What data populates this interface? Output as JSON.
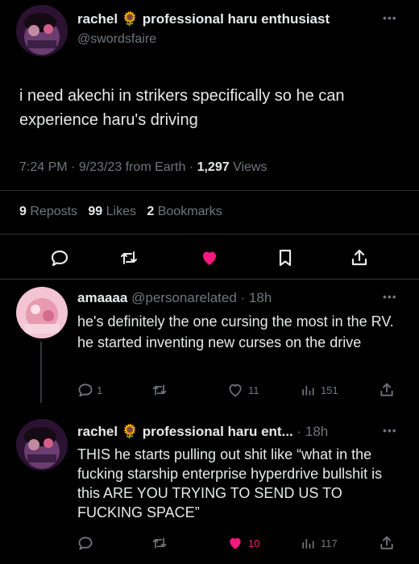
{
  "main_tweet": {
    "display_name": "rachel",
    "emoji": "🌻",
    "name_suffix": "professional haru enthusiast",
    "handle": "@swordsfaire",
    "text": "i need akechi in strikers specifically so he can experience haru's driving",
    "time": "7:24 PM",
    "date": "9/23/23 from Earth",
    "views_count": "1,297",
    "views_label": "Views",
    "reposts_count": "9",
    "reposts_label": "Reposts",
    "likes_count": "99",
    "likes_label": "Likes",
    "bookmarks_count": "2",
    "bookmarks_label": "Bookmarks",
    "actions": {
      "reply_icon": "reply-icon",
      "repost_icon": "repost-icon",
      "like_icon": "heart-icon",
      "bookmark_icon": "bookmark-icon",
      "share_icon": "share-icon"
    }
  },
  "replies": [
    {
      "display_name": "amaaaa",
      "handle": "@personarelated",
      "age": "· 18h",
      "text": "he's definitely the one cursing the most in the RV. he started inventing new curses on the drive",
      "reply_count": "1",
      "repost_count": "",
      "like_count": "11",
      "view_count": "151"
    },
    {
      "display_name": "rachel",
      "emoji": "🌻",
      "name_suffix": "professional haru ent...",
      "handle": "",
      "age": "· 18h",
      "text": "THIS he starts pulling out shit like “what in the fucking starship enterprise hyperdrive bullshit is this ARE YOU TRYING TO SEND US TO FUCKING SPACE”",
      "reply_count": "",
      "repost_count": "",
      "like_count": "10",
      "view_count": "117"
    }
  ],
  "colors": {
    "like_pink": "#f91880",
    "muted": "#71767b",
    "text": "#e7e9ea",
    "divider": "#2f3336"
  }
}
